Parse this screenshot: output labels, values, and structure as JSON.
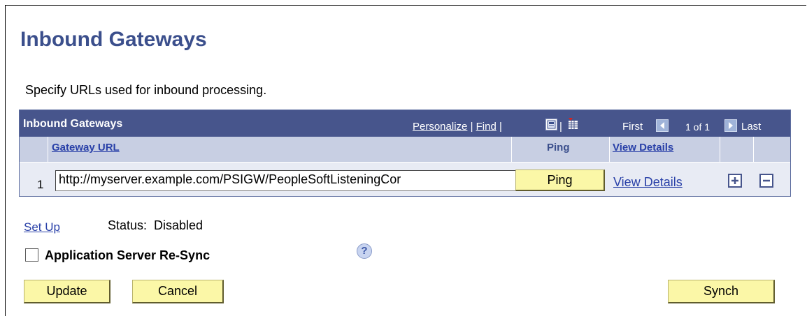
{
  "page": {
    "title": "Inbound Gateways",
    "description": "Specify URLs used for inbound processing."
  },
  "grid": {
    "title": "Inbound Gateways",
    "personalize": "Personalize",
    "separator": "|",
    "find": "Find",
    "first": "First",
    "range": "1 of 1",
    "last": "Last",
    "columns": {
      "gateway_url": "Gateway URL",
      "ping": "Ping",
      "view_details": "View Details"
    },
    "rows": [
      {
        "number": "1",
        "url": "http://myserver.example.com/PSIGW/PeopleSoftListeningCor",
        "ping_label": "Ping",
        "view_details_label": "View Details",
        "add_label": "+",
        "delete_label": "−"
      }
    ]
  },
  "setup": {
    "link": "Set Up",
    "status_label": "Status:",
    "status_value": "Disabled"
  },
  "resync": {
    "label": "Application Server Re-Sync",
    "checked": false
  },
  "help_glyph": "?",
  "buttons": {
    "update": "Update",
    "cancel": "Cancel",
    "synch": "Synch"
  },
  "icons": [
    "view-all-icon",
    "download-grid-icon",
    "first-arrow-icon",
    "last-arrow-icon",
    "add-row-icon",
    "delete-row-icon",
    "help-icon"
  ],
  "colors": {
    "title": "#3b4f8c",
    "grid_header": "#47558c",
    "column_header": "#c8cfe3",
    "row_bg": "#e8ebf4",
    "button": "#fbf7a7",
    "link": "#2940a8"
  }
}
